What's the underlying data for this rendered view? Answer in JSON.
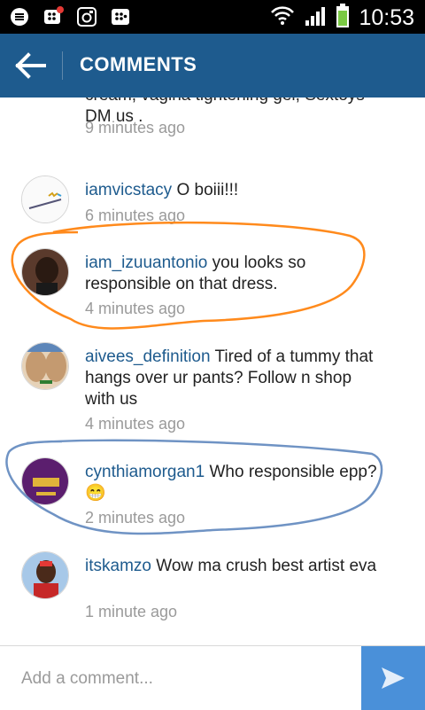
{
  "status_bar": {
    "time": "10:53",
    "left_icons": [
      "chat-bubble-icon",
      "bbm-notification-icon",
      "instagram-icon",
      "bbm-icon"
    ],
    "right_icons": [
      "wifi-icon",
      "signal-icon",
      "battery-icon"
    ]
  },
  "header": {
    "title": "COMMENTS",
    "back_icon": "arrow-left-icon",
    "color": "#1e5b8e"
  },
  "comments": [
    {
      "username": "",
      "text": "cream, vagina tightening gel, Sextoys DM us .",
      "time": "9 minutes ago",
      "partial": true
    },
    {
      "username": "iamvicstacy",
      "text": "O boiii!!!",
      "time": "6 minutes ago"
    },
    {
      "username": "iam_izuuantonio",
      "text": "you looks so responsible on that dress.",
      "time": "4 minutes ago"
    },
    {
      "username": "aivees_definition",
      "text": "Tired of a tummy that hangs over ur pants? Follow n shop with us",
      "time": "4 minutes ago"
    },
    {
      "username": "cynthiamorgan1",
      "text": "Who responsible epp? 😁",
      "time": "2 minutes ago"
    },
    {
      "username": "itskamzo",
      "text": "Wow ma crush best artist eva",
      "time": "1 minute ago"
    }
  ],
  "composer": {
    "placeholder": "Add a comment...",
    "send_icon": "send-icon",
    "send_color": "#4a90d9"
  },
  "annotations": {
    "orange": "#ff8a1c",
    "blue": "#6f93c4"
  }
}
